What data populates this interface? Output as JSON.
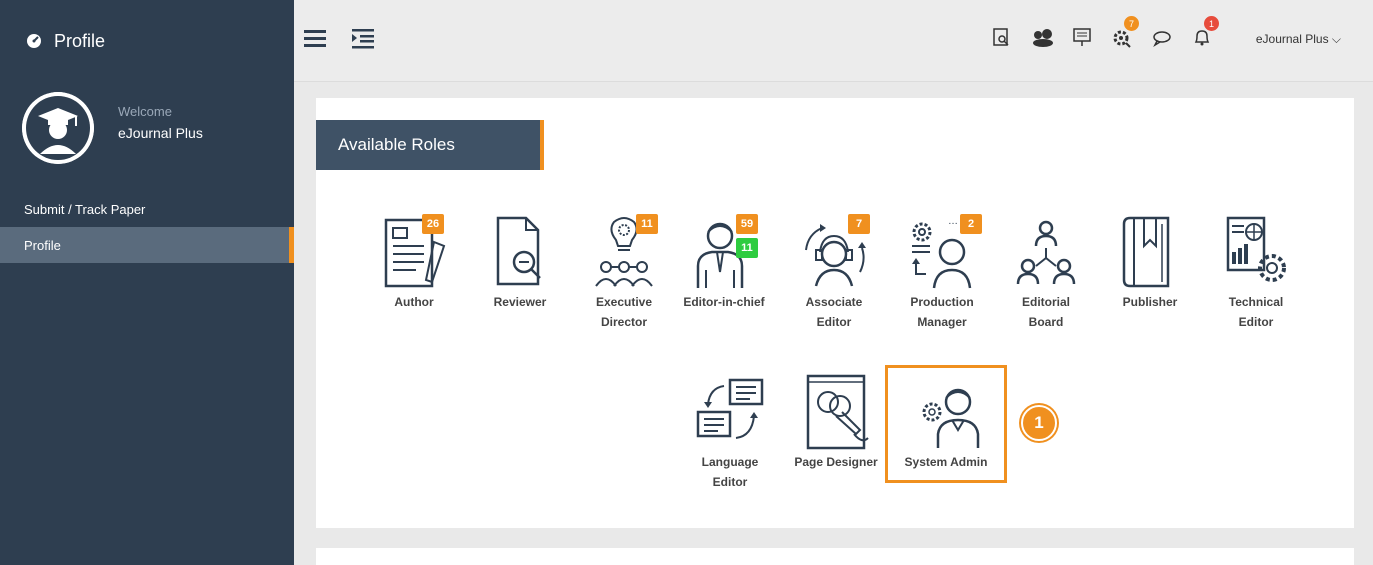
{
  "sidebar": {
    "title": "Profile",
    "welcome": "Welcome",
    "username": "eJournal Plus",
    "items": [
      {
        "label": "Submit / Track Paper"
      },
      {
        "label": "Profile"
      }
    ]
  },
  "topbar": {
    "icons": [
      {
        "name": "search-document-icon",
        "badge": ""
      },
      {
        "name": "users-icon",
        "badge": ""
      },
      {
        "name": "presentation-icon",
        "badge": ""
      },
      {
        "name": "settings-search-icon",
        "badge": "7"
      },
      {
        "name": "chat-icon",
        "badge": ""
      },
      {
        "name": "bell-icon",
        "badge": "1"
      }
    ],
    "user_menu": "eJournal Plus ⌵"
  },
  "main": {
    "section_title": "Available Roles",
    "roles": [
      {
        "line1": "Author",
        "line2": "",
        "badge": "26"
      },
      {
        "line1": "Reviewer",
        "line2": "",
        "badge": ""
      },
      {
        "line1": "Executive",
        "line2": "Director",
        "badge": "11"
      },
      {
        "line1": "Editor-in-chief",
        "line2": "",
        "badge": "59",
        "badge2": "11"
      },
      {
        "line1": "Associate",
        "line2": "Editor",
        "badge": "7"
      },
      {
        "line1": "Production",
        "line2": "Manager",
        "badge": "2"
      },
      {
        "line1": "Editorial",
        "line2": "Board",
        "badge": ""
      },
      {
        "line1": "Publisher",
        "line2": "",
        "badge": ""
      },
      {
        "line1": "Technical",
        "line2": "Editor",
        "badge": ""
      },
      {
        "line1": "Language",
        "line2": "Editor",
        "badge": ""
      },
      {
        "line1": "Page Designer",
        "line2": "",
        "badge": ""
      },
      {
        "line1": "System Admin",
        "line2": "",
        "badge": ""
      }
    ],
    "step_marker": "1"
  },
  "colors": {
    "sidebar_bg": "#2e3e50",
    "accent": "#f0901f",
    "icon_stroke": "#2e3e50",
    "badge_green": "#2ecc40"
  }
}
